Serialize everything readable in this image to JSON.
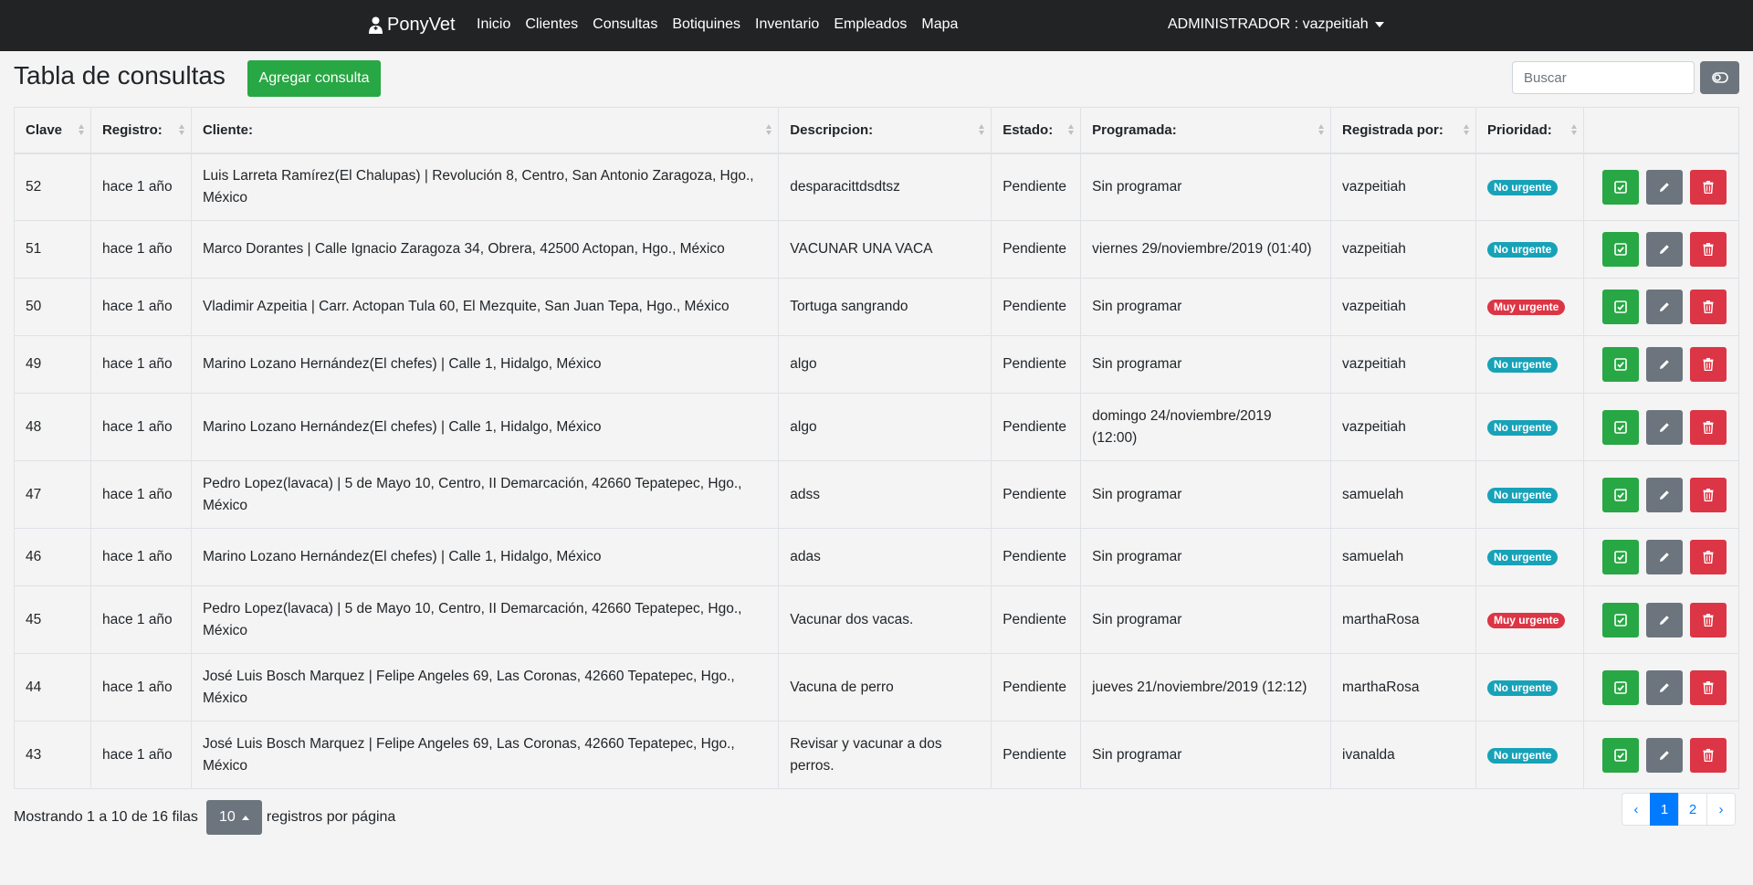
{
  "navbar": {
    "brand": "PonyVet",
    "links": [
      "Inicio",
      "Clientes",
      "Consultas",
      "Botiquines",
      "Inventario",
      "Empleados",
      "Mapa"
    ],
    "user": "ADMINISTRADOR : vazpeitiah"
  },
  "header": {
    "title": "Tabla de consultas",
    "add_button": "Agregar consulta",
    "search_placeholder": "Buscar"
  },
  "table": {
    "columns": [
      "Clave",
      "Registro:",
      "Cliente:",
      "Descripcion:",
      "Estado:",
      "Programada:",
      "Registrada por:",
      "Prioridad:"
    ],
    "rows": [
      {
        "clave": "52",
        "registro": "hace 1 año",
        "cliente": "Luis Larreta Ramírez(El Chalupas) | Revolución 8, Centro, San Antonio Zaragoza, Hgo., México",
        "descripcion": "desparacittdsdtsz",
        "estado": "Pendiente",
        "programada": "Sin programar",
        "registrada": "vazpeitiah",
        "prioridad": "No urgente"
      },
      {
        "clave": "51",
        "registro": "hace 1 año",
        "cliente": "Marco Dorantes | Calle Ignacio Zaragoza 34, Obrera, 42500 Actopan, Hgo., México",
        "descripcion": "VACUNAR UNA VACA",
        "estado": "Pendiente",
        "programada": "viernes 29/noviembre/2019 (01:40)",
        "registrada": "vazpeitiah",
        "prioridad": "No urgente"
      },
      {
        "clave": "50",
        "registro": "hace 1 año",
        "cliente": "Vladimir Azpeitia | Carr. Actopan Tula 60, El Mezquite, San Juan Tepa, Hgo., México",
        "descripcion": "Tortuga sangrando",
        "estado": "Pendiente",
        "programada": "Sin programar",
        "registrada": "vazpeitiah",
        "prioridad": "Muy urgente"
      },
      {
        "clave": "49",
        "registro": "hace 1 año",
        "cliente": "Marino Lozano Hernández(El chefes) | Calle 1, Hidalgo, México",
        "descripcion": "algo",
        "estado": "Pendiente",
        "programada": "Sin programar",
        "registrada": "vazpeitiah",
        "prioridad": "No urgente"
      },
      {
        "clave": "48",
        "registro": "hace 1 año",
        "cliente": "Marino Lozano Hernández(El chefes) | Calle 1, Hidalgo, México",
        "descripcion": "algo",
        "estado": "Pendiente",
        "programada": "domingo 24/noviembre/2019 (12:00)",
        "registrada": "vazpeitiah",
        "prioridad": "No urgente"
      },
      {
        "clave": "47",
        "registro": "hace 1 año",
        "cliente": "Pedro Lopez(lavaca) | 5 de Mayo 10, Centro, II Demarcación, 42660 Tepatepec, Hgo., México",
        "descripcion": "adss",
        "estado": "Pendiente",
        "programada": "Sin programar",
        "registrada": "samuelah",
        "prioridad": "No urgente"
      },
      {
        "clave": "46",
        "registro": "hace 1 año",
        "cliente": "Marino Lozano Hernández(El chefes) | Calle 1, Hidalgo, México",
        "descripcion": "adas",
        "estado": "Pendiente",
        "programada": "Sin programar",
        "registrada": "samuelah",
        "prioridad": "No urgente"
      },
      {
        "clave": "45",
        "registro": "hace 1 año",
        "cliente": "Pedro Lopez(lavaca) | 5 de Mayo 10, Centro, II Demarcación, 42660 Tepatepec, Hgo., México",
        "descripcion": "Vacunar dos vacas.",
        "estado": "Pendiente",
        "programada": "Sin programar",
        "registrada": "marthaRosa",
        "prioridad": "Muy urgente"
      },
      {
        "clave": "44",
        "registro": "hace 1 año",
        "cliente": "José Luis Bosch Marquez | Felipe Angeles 69, Las Coronas, 42660 Tepatepec, Hgo., México",
        "descripcion": "Vacuna de perro",
        "estado": "Pendiente",
        "programada": "jueves 21/noviembre/2019 (12:12)",
        "registrada": "marthaRosa",
        "prioridad": "No urgente"
      },
      {
        "clave": "43",
        "registro": "hace 1 año",
        "cliente": "José Luis Bosch Marquez | Felipe Angeles 69, Las Coronas, 42660 Tepatepec, Hgo., México",
        "descripcion": "Revisar y vacunar a dos perros.",
        "estado": "Pendiente",
        "programada": "Sin programar",
        "registrada": "ivanalda",
        "prioridad": "No urgente"
      }
    ]
  },
  "priority_colors": {
    "No urgente": "#17a2b8",
    "Muy urgente": "#dc3545"
  },
  "footer": {
    "showing": "Mostrando 1 a 10 de 16 filas",
    "page_size": "10",
    "per_page": "registros por página",
    "pages": [
      "‹",
      "1",
      "2",
      "›"
    ],
    "active_page": "1"
  },
  "icons": {
    "brand": "vet-logo-icon",
    "toggle": "toggle-icon",
    "complete": "check-square-icon",
    "edit": "pencil-icon",
    "delete": "trash-icon"
  }
}
